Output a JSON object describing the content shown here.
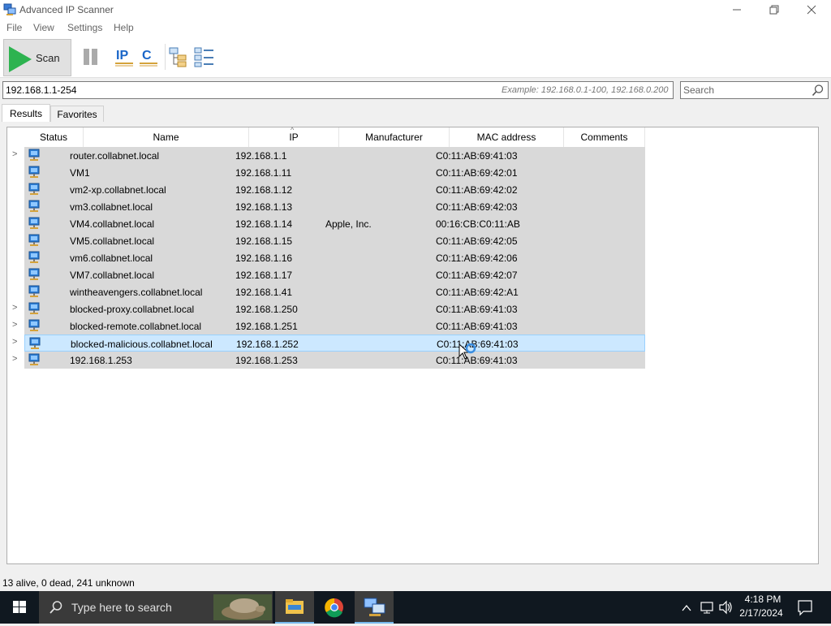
{
  "window": {
    "title": "Advanced IP Scanner",
    "minimize_icon": "minimize-icon",
    "maximize_icon": "restore-icon",
    "close_icon": "close-icon"
  },
  "menu": [
    "File",
    "View",
    "Settings",
    "Help"
  ],
  "toolbar": {
    "scan_label": "Scan",
    "pause_icon": "pause-icon",
    "ip_icon_text": "IP",
    "c_icon_text": "C",
    "expand_icon": "expand-all-icon",
    "collapse_icon": "collapse-all-icon"
  },
  "address": {
    "value": "192.168.1.1-254",
    "example": "Example: 192.168.0.1-100, 192.168.0.200"
  },
  "search": {
    "placeholder": "Search"
  },
  "tabs": [
    "Results",
    "Favorites"
  ],
  "columns": [
    "Status",
    "Name",
    "IP",
    "Manufacturer",
    "MAC address",
    "Comments"
  ],
  "rows": [
    {
      "expandable": true,
      "name": "router.collabnet.local",
      "ip": "192.168.1.1",
      "manufacturer": "",
      "mac": "C0:11:AB:69:41:03",
      "comments": ""
    },
    {
      "expandable": false,
      "name": "VM1",
      "ip": "192.168.1.11",
      "manufacturer": "",
      "mac": "C0:11:AB:69:42:01",
      "comments": ""
    },
    {
      "expandable": false,
      "name": "vm2-xp.collabnet.local",
      "ip": "192.168.1.12",
      "manufacturer": "",
      "mac": "C0:11:AB:69:42:02",
      "comments": ""
    },
    {
      "expandable": false,
      "name": "vm3.collabnet.local",
      "ip": "192.168.1.13",
      "manufacturer": "",
      "mac": "C0:11:AB:69:42:03",
      "comments": ""
    },
    {
      "expandable": false,
      "name": "VM4.collabnet.local",
      "ip": "192.168.1.14",
      "manufacturer": "Apple, Inc.",
      "mac": "00:16:CB:C0:11:AB",
      "comments": ""
    },
    {
      "expandable": false,
      "name": "VM5.collabnet.local",
      "ip": "192.168.1.15",
      "manufacturer": "",
      "mac": "C0:11:AB:69:42:05",
      "comments": ""
    },
    {
      "expandable": false,
      "name": "vm6.collabnet.local",
      "ip": "192.168.1.16",
      "manufacturer": "",
      "mac": "C0:11:AB:69:42:06",
      "comments": ""
    },
    {
      "expandable": false,
      "name": "VM7.collabnet.local",
      "ip": "192.168.1.17",
      "manufacturer": "",
      "mac": "C0:11:AB:69:42:07",
      "comments": ""
    },
    {
      "expandable": false,
      "name": "wintheavengers.collabnet.local",
      "ip": "192.168.1.41",
      "manufacturer": "",
      "mac": "C0:11:AB:69:42:A1",
      "comments": ""
    },
    {
      "expandable": true,
      "name": "blocked-proxy.collabnet.local",
      "ip": "192.168.1.250",
      "manufacturer": "",
      "mac": "C0:11:AB:69:41:03",
      "comments": ""
    },
    {
      "expandable": true,
      "name": "blocked-remote.collabnet.local",
      "ip": "192.168.1.251",
      "manufacturer": "",
      "mac": "C0:11:AB:69:41:03",
      "comments": ""
    },
    {
      "expandable": true,
      "name": "blocked-malicious.collabnet.local",
      "ip": "192.168.1.252",
      "manufacturer": "",
      "mac": "C0:11:AB:69:41:03",
      "comments": "",
      "selected": true
    },
    {
      "expandable": true,
      "name": "192.168.1.253",
      "ip": "192.168.1.253",
      "manufacturer": "",
      "mac": "C0:11:AB:69:41:03",
      "comments": ""
    }
  ],
  "status": "13 alive, 0 dead, 241 unknown",
  "taskbar": {
    "search_placeholder": "Type here to search",
    "time": "4:18 PM",
    "date": "2/17/2024",
    "apps": [
      "file-explorer-icon",
      "chrome-icon",
      "advanced-ip-scanner-icon"
    ],
    "tray_icons": [
      "chevron-up-icon",
      "network-icon",
      "volume-icon",
      "notification-icon"
    ]
  },
  "colors": {
    "scan_green": "#2db350",
    "row_bg": "#d9d9d9",
    "selected_row_bg": "#cce8ff",
    "ip_icon_blue": "#1a66c8",
    "taskbar_bg": "#101820"
  }
}
